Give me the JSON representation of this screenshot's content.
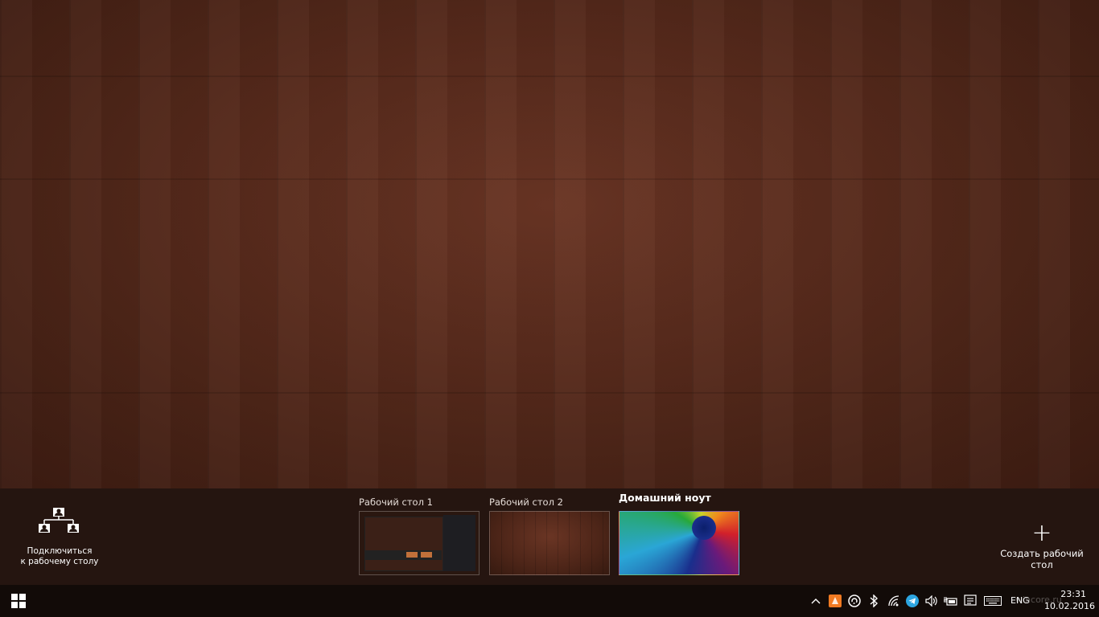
{
  "task_view": {
    "connect": {
      "label_line1": "Подключиться",
      "label_line2": "к рабочему столу",
      "icon": "network-icon"
    },
    "desktops": [
      {
        "title": "Рабочий стол 1",
        "active": false
      },
      {
        "title": "Рабочий стол 2",
        "active": false
      },
      {
        "title": "Домашний ноут",
        "active": true
      }
    ],
    "new_desktop": {
      "label": "Создать рабочий стол",
      "icon": "plus-icon"
    }
  },
  "taskbar": {
    "start_icon": "windows-logo-icon",
    "tray_icons": [
      "chevron-up-icon",
      "app-orange-icon",
      "sync-icon",
      "bluetooth-icon",
      "wifi-icon",
      "telegram-icon",
      "volume-icon",
      "power-icon",
      "notes-icon",
      "keyboard-icon"
    ],
    "language": "ENG",
    "time": "23:31",
    "date": "10.02.2016",
    "watermark": "wincore.ru"
  },
  "colors": {
    "taskbar_bg": "#120b08",
    "taskview_bg": "#22140f",
    "wallpaper": "#55291b",
    "accent_telegram": "#2ca5e0",
    "accent_orange": "#f07a22"
  }
}
